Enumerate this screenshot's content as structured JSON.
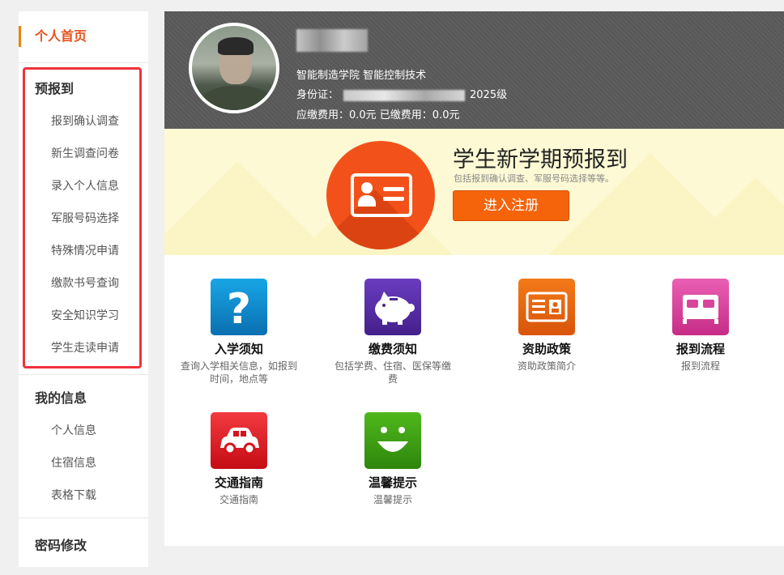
{
  "sidebar": {
    "home": "个人首页",
    "prereg": {
      "title": "预报到",
      "items": [
        "报到确认调查",
        "新生调查问卷",
        "录入个人信息",
        "军服号码选择",
        "特殊情况申请",
        "缴款书号查询",
        "安全知识学习",
        "学生走读申请"
      ]
    },
    "myinfo": {
      "title": "我的信息",
      "items": [
        "个人信息",
        "住宿信息",
        "表格下载"
      ]
    },
    "password": "密码修改"
  },
  "profile": {
    "college_major": "智能制造学院  智能控制技术",
    "id_label": "身份证：",
    "grade": "2025级",
    "fees": "应缴费用：0.0元   已缴费用：0.0元"
  },
  "banner": {
    "title": "学生新学期预报到",
    "subtitle": "包括报到确认调查、军服号码选择等等。",
    "button": "进入注册"
  },
  "tiles": [
    {
      "title": "入学须知",
      "desc": "查询入学相关信息，如报到时间，地点等",
      "icon": "question-icon",
      "color": "#0e86c8"
    },
    {
      "title": "缴费须知",
      "desc": "包括学费、住宿、医保等缴费",
      "icon": "piggy-bank-icon",
      "color": "#5a2fa8"
    },
    {
      "title": "资助政策",
      "desc": "资助政策简介",
      "icon": "id-card-icon",
      "color": "#e65f0c"
    },
    {
      "title": "报到流程",
      "desc": "报到流程",
      "icon": "bed-icon",
      "color": "#d9399b"
    },
    {
      "title": "交通指南",
      "desc": "交通指南",
      "icon": "car-icon",
      "color": "#e2161e"
    },
    {
      "title": "温馨提示",
      "desc": "温馨提示",
      "icon": "smiley-icon",
      "color": "#3d9a12"
    }
  ],
  "colors": {
    "accent": "#f5630a",
    "highlight_box": "#f0323c"
  }
}
